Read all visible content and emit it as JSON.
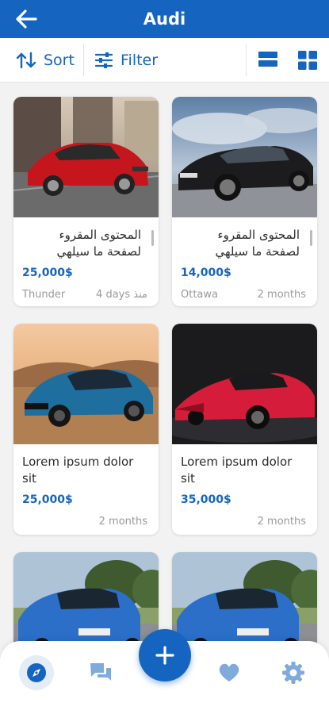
{
  "header": {
    "title": "Audi"
  },
  "toolbar": {
    "sort_label": "Sort",
    "filter_label": "Filter"
  },
  "colors": {
    "primary": "#1565c0",
    "background": "#f2f2f2",
    "text": "#2b2b2b",
    "muted": "#9a9a9a"
  },
  "listings": [
    {
      "title": "المحتوى المقروء لصفحة ما سيلهي",
      "price": "25,000$",
      "location": "Thunder",
      "time": "4 days منذ",
      "image": "red-ford-sedan"
    },
    {
      "title": "المحتوى المقروء لصفحة ما سيلهي",
      "price": "14,000$",
      "location": "Ottawa",
      "time": "2 months",
      "image": "black-mustang"
    },
    {
      "title": "Lorem ipsum dolor sit",
      "price": "25,000$",
      "location": "",
      "time": "2 months",
      "image": "blue-camaro"
    },
    {
      "title": "Lorem ipsum dolor sit",
      "price": "35,000$",
      "location": "",
      "time": "2 months",
      "image": "red-corvette"
    },
    {
      "title": "",
      "price": "",
      "location": "",
      "time": "",
      "image": "blue-ford-focus"
    },
    {
      "title": "",
      "price": "",
      "location": "",
      "time": "",
      "image": "blue-ford-focus"
    }
  ],
  "bottom_nav": {
    "items": [
      {
        "icon": "compass-icon",
        "active": true
      },
      {
        "icon": "chat-icon",
        "active": false
      },
      {
        "icon": "heart-icon",
        "active": false
      },
      {
        "icon": "gear-icon",
        "active": false
      }
    ],
    "fab_icon": "plus-icon"
  }
}
